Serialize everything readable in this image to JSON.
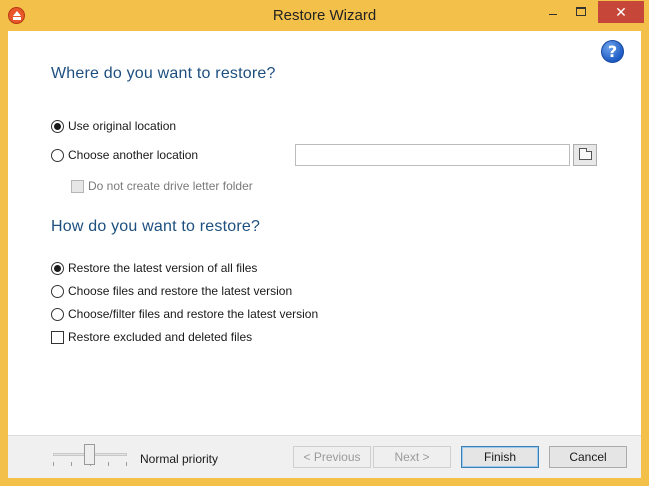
{
  "window": {
    "title": "Restore Wizard"
  },
  "section_location": {
    "heading": "Where do you want to restore?",
    "options": [
      {
        "label": "Use original location",
        "selected": true
      },
      {
        "label": "Choose another location",
        "selected": false
      }
    ],
    "path_value": "",
    "drive_letter_label": "Do not create drive letter folder",
    "drive_letter_checked": false,
    "drive_letter_enabled": false
  },
  "section_method": {
    "heading": "How do you want to restore?",
    "options": [
      {
        "label": "Restore the latest version of all files",
        "selected": true
      },
      {
        "label": "Choose files and restore the latest version",
        "selected": false
      },
      {
        "label": "Choose/filter files and restore the latest version",
        "selected": false
      }
    ],
    "excluded_label": "Restore excluded and deleted files",
    "excluded_checked": false
  },
  "footer": {
    "priority_label": "Normal priority",
    "priority_level": 0.5,
    "buttons": {
      "previous": "< Previous",
      "next": "Next >",
      "finish": "Finish",
      "cancel": "Cancel"
    }
  },
  "colors": {
    "frame": "#f3c14a",
    "heading": "#1d4f7f",
    "close": "#c7463a"
  },
  "icons": {
    "app": "app-restore-icon",
    "help": "help-icon",
    "browse": "folder-icon"
  }
}
